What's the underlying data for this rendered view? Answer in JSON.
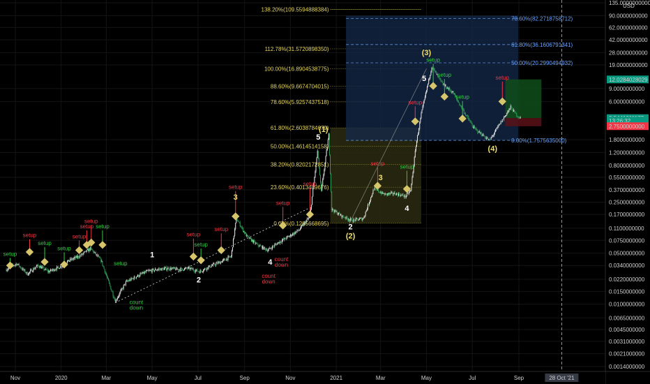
{
  "chart_data": {
    "type": "candlestick",
    "yscale": "log",
    "ylim": [
      0.0012,
      135
    ],
    "currency": "USD",
    "x_ticks": [
      "Nov",
      "2020",
      "Mar",
      "May",
      "Jul",
      "Sep",
      "Nov",
      "2021",
      "Mar",
      "May",
      "Jul",
      "Sep"
    ],
    "cursor_date": "28 Oct '21",
    "y_ticks": [
      {
        "label": "135.0000000000",
        "value": 135
      },
      {
        "label": "90.0000000000",
        "value": 90
      },
      {
        "label": "62.0000000000",
        "value": 62
      },
      {
        "label": "42.0000000000",
        "value": 42
      },
      {
        "label": "28.0000000000",
        "value": 28
      },
      {
        "label": "19.0000000000",
        "value": 19
      },
      {
        "label": "9.0000000000",
        "value": 9
      },
      {
        "label": "6.0000000000",
        "value": 6
      },
      {
        "label": "1.8000000000",
        "value": 1.8
      },
      {
        "label": "1.2000000000",
        "value": 1.2
      },
      {
        "label": "0.8000000000",
        "value": 0.8
      },
      {
        "label": "0.5500000000",
        "value": 0.55
      },
      {
        "label": "0.3700000000",
        "value": 0.37
      },
      {
        "label": "0.2500000000",
        "value": 0.25
      },
      {
        "label": "0.1700000000",
        "value": 0.17
      },
      {
        "label": "0.1100000000",
        "value": 0.11
      },
      {
        "label": "0.0750000000",
        "value": 0.075
      },
      {
        "label": "0.0500000000",
        "value": 0.05
      },
      {
        "label": "0.0340000000",
        "value": 0.034
      },
      {
        "label": "0.0220000000",
        "value": 0.022
      },
      {
        "label": "0.0150000000",
        "value": 0.015
      },
      {
        "label": "0.0100000000",
        "value": 0.01
      },
      {
        "label": "0.0065000000",
        "value": 0.0065
      },
      {
        "label": "0.0045000000",
        "value": 0.0045
      },
      {
        "label": "0.0031000000",
        "value": 0.0031
      },
      {
        "label": "0.0021000000",
        "value": 0.0021
      },
      {
        "label": "0.0014000000",
        "value": 0.0014
      }
    ],
    "price_tags": [
      {
        "label": "12.0284028029",
        "value": 12.03,
        "color": "#089981"
      },
      {
        "label": "3.5586013395",
        "value": 3.5586,
        "color": "#2a2e39"
      },
      {
        "label": "3.5441011177",
        "value": 3.5441,
        "color": "#089981"
      },
      {
        "label": "13:26:32",
        "value": 3.27,
        "color": "#089981"
      },
      {
        "label": "2.7500000000",
        "value": 2.75,
        "color": "#f23645"
      }
    ],
    "fib_extension": {
      "levels": [
        {
          "label": "138.20%(109.5594888384)",
          "value": 109.56
        },
        {
          "label": "112.78%(31.5720898350)",
          "value": 31.57
        },
        {
          "label": "100.00%(16.8904538775)",
          "value": 16.89
        },
        {
          "label": "88.60%(9.6674704015)",
          "value": 9.667
        },
        {
          "label": "78.60%(5.9257437518)",
          "value": 5.926
        },
        {
          "label": "61.80%(2.6038784679)",
          "value": 2.604
        },
        {
          "label": "50.00%(1.4614514158)",
          "value": 1.461
        },
        {
          "label": "38.20%(0.8202172851)",
          "value": 0.8202
        },
        {
          "label": "23.60%(0.4013489676)",
          "value": 0.4013
        },
        {
          "label": "0.00%(0.1285668695)",
          "value": 0.1286
        }
      ]
    },
    "fib_retracement": {
      "levels": [
        {
          "label": "78.60%(82.2718758712)",
          "value": 82.27
        },
        {
          "label": "61.80%(36.1606791341)",
          "value": 36.16
        },
        {
          "label": "50.00%(20.2990494932)",
          "value": 20.3
        },
        {
          "label": "0.00%(1.7575635000)",
          "value": 1.7576
        }
      ]
    },
    "price_series": [
      [
        "2019-10-20",
        0.03
      ],
      [
        "2019-11-03",
        0.036
      ],
      [
        "2019-11-17",
        0.026
      ],
      [
        "2019-12-01",
        0.034
      ],
      [
        "2019-12-15",
        0.028
      ],
      [
        "2019-12-29",
        0.032
      ],
      [
        "2020-01-12",
        0.04
      ],
      [
        "2020-01-26",
        0.046
      ],
      [
        "2020-02-09",
        0.058
      ],
      [
        "2020-02-23",
        0.04
      ],
      [
        "2020-03-13",
        0.011
      ],
      [
        "2020-03-27",
        0.02
      ],
      [
        "2020-04-10",
        0.024
      ],
      [
        "2020-04-24",
        0.028
      ],
      [
        "2020-05-08",
        0.03
      ],
      [
        "2020-05-22",
        0.031
      ],
      [
        "2020-06-05",
        0.03
      ],
      [
        "2020-06-19",
        0.031
      ],
      [
        "2020-07-03",
        0.028
      ],
      [
        "2020-07-17",
        0.033
      ],
      [
        "2020-07-31",
        0.038
      ],
      [
        "2020-08-14",
        0.045
      ],
      [
        "2020-08-21",
        0.15
      ],
      [
        "2020-09-04",
        0.085
      ],
      [
        "2020-09-18",
        0.065
      ],
      [
        "2020-10-02",
        0.055
      ],
      [
        "2020-10-16",
        0.07
      ],
      [
        "2020-10-30",
        0.085
      ],
      [
        "2020-11-13",
        0.105
      ],
      [
        "2020-11-27",
        0.16
      ],
      [
        "2020-12-07",
        1.25
      ],
      [
        "2020-12-12",
        0.35
      ],
      [
        "2020-12-22",
        2.1
      ],
      [
        "2020-12-26",
        0.2
      ],
      [
        "2021-01-09",
        0.16
      ],
      [
        "2021-01-23",
        0.14
      ],
      [
        "2021-02-06",
        0.15
      ],
      [
        "2021-02-20",
        0.38
      ],
      [
        "2021-03-06",
        0.32
      ],
      [
        "2021-03-20",
        0.33
      ],
      [
        "2021-04-03",
        0.3
      ],
      [
        "2021-04-10",
        0.36
      ],
      [
        "2021-04-17",
        1.5
      ],
      [
        "2021-04-24",
        4.0
      ],
      [
        "2021-05-08",
        18.0
      ],
      [
        "2021-05-22",
        10.5
      ],
      [
        "2021-06-05",
        8.0
      ],
      [
        "2021-06-19",
        4.5
      ],
      [
        "2021-07-03",
        2.6
      ],
      [
        "2021-07-17",
        2.0
      ],
      [
        "2021-07-24",
        1.75
      ],
      [
        "2021-08-07",
        3.0
      ],
      [
        "2021-08-21",
        5.0
      ],
      [
        "2021-08-28",
        4.0
      ],
      [
        "2021-09-03",
        3.55
      ]
    ],
    "annotations": [
      {
        "text": "setup",
        "date": "2019-10-25",
        "price": 0.046,
        "color": "#2ecc40",
        "marker": 0.034
      },
      {
        "text": "setup",
        "date": "2019-11-20",
        "price": 0.083,
        "color": "#f23645",
        "marker": 0.052
      },
      {
        "text": "setup",
        "date": "2019-12-10",
        "price": 0.065,
        "color": "#2ecc40",
        "marker": 0.038
      },
      {
        "text": "setup",
        "date": "2020-01-05",
        "price": 0.055,
        "color": "#2ecc40",
        "marker": 0.035
      },
      {
        "text": "setup",
        "date": "2020-01-25",
        "price": 0.08,
        "color": "#f23645",
        "marker": 0.055
      },
      {
        "text": "setup",
        "date": "2020-02-04",
        "price": 0.11,
        "color": "#f23645",
        "marker": 0.065
      },
      {
        "text": "setup",
        "date": "2020-02-10",
        "price": 0.13,
        "color": "#f23645",
        "marker": 0.07
      },
      {
        "text": "setup",
        "date": "2020-02-25",
        "price": 0.11,
        "color": "#2ecc40",
        "marker": 0.065
      },
      {
        "text": "setup",
        "date": "2020-03-20",
        "price": 0.034,
        "color": "#2ecc40",
        "marker": null
      },
      {
        "text": "setup",
        "date": "2020-06-25",
        "price": 0.085,
        "color": "#f23645",
        "marker": 0.045
      },
      {
        "text": "setup",
        "date": "2020-07-05",
        "price": 0.062,
        "color": "#2ecc40",
        "marker": 0.04
      },
      {
        "text": "setup",
        "date": "2020-08-01",
        "price": 0.1,
        "color": "#f23645",
        "marker": 0.055
      },
      {
        "text": "setup",
        "date": "2020-08-20",
        "price": 0.38,
        "color": "#f23645",
        "marker": 0.16
      },
      {
        "text": "setup",
        "date": "2020-10-22",
        "price": 0.23,
        "color": "#f23645",
        "marker": 0.12
      },
      {
        "text": "setup",
        "date": "2020-11-27",
        "price": 0.42,
        "color": "#f23645",
        "marker": 0.17
      },
      {
        "text": "setup",
        "date": "2021-02-25",
        "price": 0.8,
        "color": "#f23645",
        "marker": 0.42
      },
      {
        "text": "setup",
        "date": "2021-04-05",
        "price": 0.72,
        "color": "#2ecc40",
        "marker": 0.38
      },
      {
        "text": "setup",
        "date": "2021-04-16",
        "price": 5.5,
        "color": "#f23645",
        "marker": 3.2
      },
      {
        "text": "setup",
        "date": "2021-05-10",
        "price": 21.0,
        "color": "#2ecc40",
        "marker": 9.8
      },
      {
        "text": "setup",
        "date": "2021-05-25",
        "price": 13.0,
        "color": "#2ecc40",
        "marker": 7.0
      },
      {
        "text": "setup",
        "date": "2021-06-18",
        "price": 6.5,
        "color": "#2ecc40",
        "marker": 3.5
      },
      {
        "text": "setup",
        "date": "2021-08-10",
        "price": 12.0,
        "color": "#f23645",
        "marker": 6.0
      },
      {
        "text": "count\ndown",
        "date": "2020-04-10",
        "price": 0.01,
        "color": "#2ecc40",
        "marker": null
      },
      {
        "text": "count\ndown",
        "date": "2020-10-03",
        "price": 0.023,
        "color": "#f23645",
        "marker": null
      },
      {
        "text": "count\ndown",
        "date": "2020-10-20",
        "price": 0.039,
        "color": "#f23645",
        "marker": null
      }
    ],
    "wave_labels": [
      {
        "text": "1",
        "date": "2020-05-01",
        "price": 0.044
      },
      {
        "text": "2",
        "date": "2020-07-02",
        "price": 0.02
      },
      {
        "text": "3",
        "date": "2020-08-20",
        "price": 0.27
      },
      {
        "text": "4",
        "date": "2020-10-05",
        "price": 0.035
      },
      {
        "text": "5",
        "date": "2020-12-08",
        "price": 1.8
      },
      {
        "text": "(1)",
        "date": "2020-12-15",
        "price": 2.3
      },
      {
        "text": "2",
        "date": "2021-01-20",
        "price": 0.106
      },
      {
        "text": "(2)",
        "date": "2021-01-20",
        "price": 0.08
      },
      {
        "text": "3",
        "date": "2021-03-01",
        "price": 0.5
      },
      {
        "text": "4",
        "date": "2021-04-05",
        "price": 0.19
      },
      {
        "text": "(3)",
        "date": "2021-05-01",
        "price": 26.0
      },
      {
        "text": "5",
        "date": "2021-04-28",
        "price": 11.5
      },
      {
        "text": "(4)",
        "date": "2021-07-28",
        "price": 1.25
      }
    ]
  }
}
